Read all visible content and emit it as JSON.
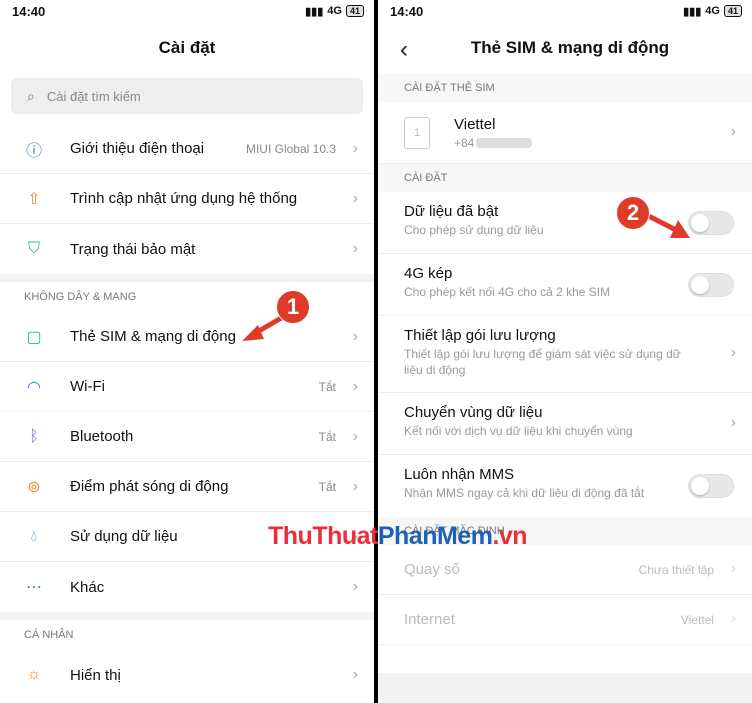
{
  "status": {
    "time": "14:40",
    "network": "4G",
    "battery": "41"
  },
  "left": {
    "title": "Cài đặt",
    "search_placeholder": "Cài đặt tìm kiếm",
    "group1": [
      {
        "icon": "info-icon",
        "label": "Giới thiệu điện thoại",
        "value": "MIUI Global 10.3"
      },
      {
        "icon": "update-icon",
        "label": "Trình cập nhật ứng dụng hệ thống",
        "value": ""
      },
      {
        "icon": "shield-icon",
        "label": "Trạng thái bảo mật",
        "value": ""
      }
    ],
    "section_wireless": "KHÔNG DÂY & MẠNG",
    "group2": [
      {
        "icon": "sim-icon",
        "label": "Thẻ SIM & mạng di động",
        "value": ""
      },
      {
        "icon": "wifi-icon",
        "label": "Wi-Fi",
        "value": "Tắt"
      },
      {
        "icon": "bluetooth-icon",
        "label": "Bluetooth",
        "value": "Tắt"
      },
      {
        "icon": "hotspot-icon",
        "label": "Điểm phát sóng di động",
        "value": "Tắt"
      },
      {
        "icon": "data-usage-icon",
        "label": "Sử dụng dữ liệu",
        "value": ""
      },
      {
        "icon": "more-icon",
        "label": "Khác",
        "value": ""
      }
    ],
    "section_personal": "CÁ NHÂN",
    "group3": [
      {
        "icon": "display-icon",
        "label": "Hiển thị",
        "value": ""
      }
    ],
    "badge": "1"
  },
  "right": {
    "title": "Thẻ SIM & mạng di động",
    "section_sim": "CÀI ĐẶT THẺ SIM",
    "sim": {
      "slot": "1",
      "carrier": "Viettel",
      "number": "+84"
    },
    "section_settings": "CÀI ĐẶT",
    "settings": [
      {
        "label": "Dữ liệu đã bật",
        "sub": "Cho phép sử dụng dữ liệu",
        "kind": "toggle"
      },
      {
        "label": "4G kép",
        "sub": "Cho phép kết nối 4G cho cả 2 khe SIM",
        "kind": "toggle"
      },
      {
        "label": "Thiết lập gói lưu lượng",
        "sub": "Thiết lập gói lưu lượng để giám sát việc sử dụng dữ liệu di động",
        "kind": "chevron"
      },
      {
        "label": "Chuyển vùng dữ liệu",
        "sub": "Kết nối với dịch vụ dữ liệu khi chuyển vùng",
        "kind": "chevron"
      },
      {
        "label": "Luôn nhận MMS",
        "sub": "Nhận MMS ngay cả khi dữ liệu di động đã tắt",
        "kind": "toggle"
      }
    ],
    "section_default": "CÀI ĐẶT MẶC ĐỊNH",
    "defaults": [
      {
        "label": "Quay số",
        "value": "Chưa thiết lập"
      },
      {
        "label": "Internet",
        "value": "Viettel"
      }
    ],
    "badge": "2"
  },
  "watermark": {
    "part1": "ThuThuat",
    "part2": "PhanMem",
    "part3": ".vn"
  },
  "colors": {
    "accent_red": "#e03b2a",
    "icon_blue": "#2f7fd6",
    "wm_red": "#e8303a",
    "wm_blue": "#1f5fb8"
  }
}
